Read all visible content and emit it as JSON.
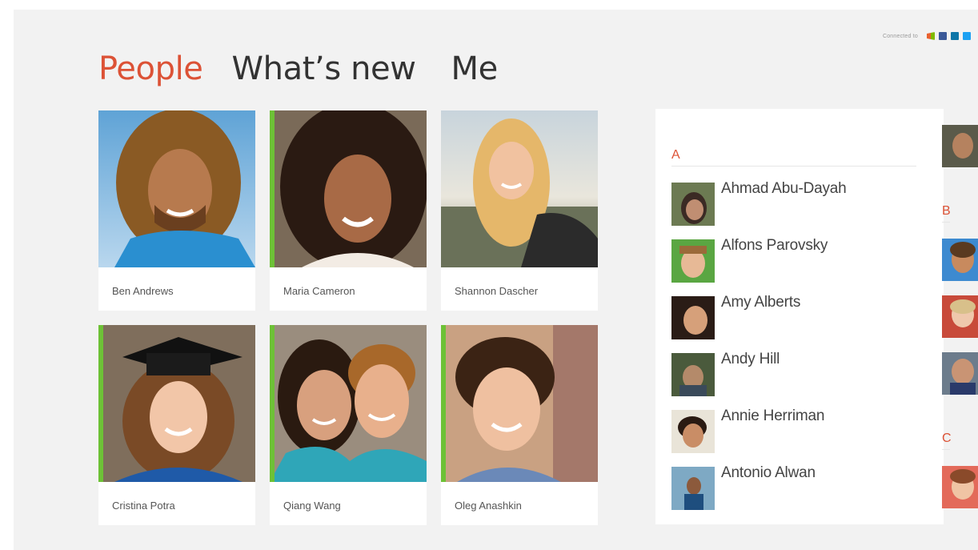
{
  "connected": {
    "label": "Connected to",
    "services": [
      "windows-live-icon",
      "facebook-icon",
      "linkedin-icon",
      "twitter-icon"
    ]
  },
  "tabs": [
    {
      "label": "People",
      "active": true
    },
    {
      "label": "What’s new",
      "active": false
    },
    {
      "label": "Me",
      "active": false
    }
  ],
  "favorites": [
    {
      "name": "Ben Andrews"
    },
    {
      "name": "Maria Cameron"
    },
    {
      "name": "Shannon Dascher"
    },
    {
      "name": "Cristina Potra"
    },
    {
      "name": "Qiang Wang"
    },
    {
      "name": "Oleg Anashkin"
    }
  ],
  "list": {
    "groups": [
      {
        "letter": "A",
        "contacts": [
          {
            "name": "Ahmad Abu-Dayah"
          },
          {
            "name": "Alfons Parovsky"
          },
          {
            "name": "Amy Alberts"
          },
          {
            "name": "Andy Hill"
          },
          {
            "name": "Annie Herriman"
          },
          {
            "name": "Antonio Alwan"
          }
        ]
      },
      {
        "letter": "B"
      },
      {
        "letter": "C"
      }
    ]
  },
  "colors": {
    "accent": "#dc5236",
    "favorite_marker": "#6dc136",
    "background": "#f2f2f2"
  }
}
